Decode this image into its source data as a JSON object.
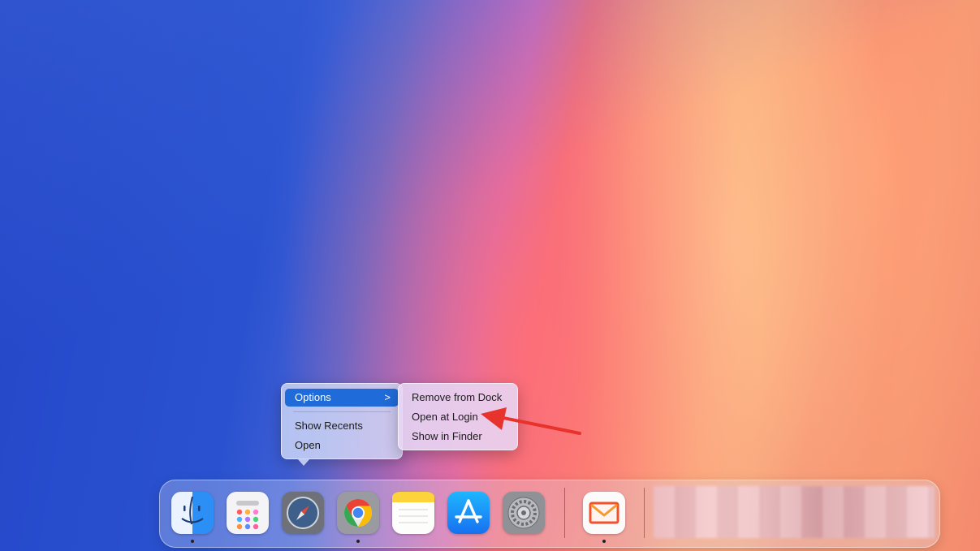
{
  "context_menu": {
    "items": [
      {
        "label": "Options",
        "has_submenu": true,
        "chevron": ">"
      },
      {
        "label": "Show Recents"
      },
      {
        "label": "Open"
      }
    ]
  },
  "submenu": {
    "items": [
      {
        "label": "Remove from Dock"
      },
      {
        "label": "Open at Login"
      },
      {
        "label": "Show in Finder"
      }
    ]
  },
  "annotation": {
    "arrow_color": "#e8322c"
  },
  "dock": {
    "apps": [
      {
        "icon": "finder-icon",
        "running": true
      },
      {
        "icon": "launchpad-icon",
        "running": false
      },
      {
        "icon": "safari-icon",
        "running": false
      },
      {
        "icon": "chrome-icon",
        "running": true
      },
      {
        "icon": "notes-icon",
        "running": false
      },
      {
        "icon": "app-store-icon",
        "running": false
      },
      {
        "icon": "system-settings-icon",
        "running": false
      },
      {
        "icon": "mail-icon",
        "running": true
      }
    ]
  },
  "colors": {
    "selection": "#1f6bd9"
  }
}
